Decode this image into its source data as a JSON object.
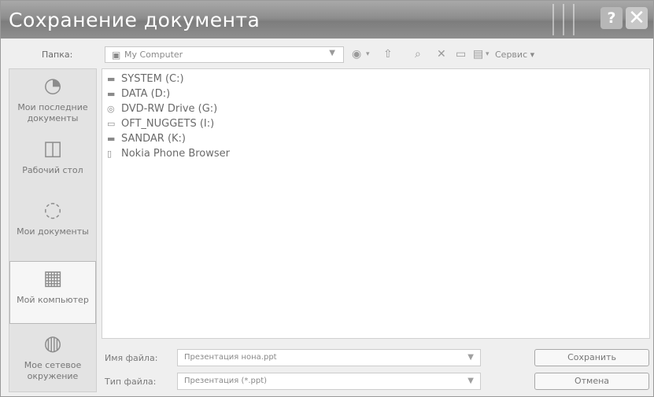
{
  "window": {
    "title": "Сохранение документа",
    "help": "?",
    "close": "✕"
  },
  "toolbar": {
    "folder_label": "Папка:",
    "folder_value": "My Computer",
    "tools_label": "Сервис"
  },
  "places": [
    {
      "label": "Мои последние документы",
      "icon": "clock-icon"
    },
    {
      "label": "Рабочий стол",
      "icon": "desktop-icon"
    },
    {
      "label": "Мои документы",
      "icon": "documents-icon"
    },
    {
      "label": "Мой компьютер",
      "icon": "computer-icon",
      "selected": true
    },
    {
      "label": "Мое сетевое окружение",
      "icon": "network-icon"
    }
  ],
  "files": [
    {
      "name": "SYSTEM (C:)",
      "icon": "drive-icon"
    },
    {
      "name": "DATA (D:)",
      "icon": "drive-icon"
    },
    {
      "name": "DVD-RW Drive (G:)",
      "icon": "dvd-icon"
    },
    {
      "name": "OFT_NUGGETS (I:)",
      "icon": "usb-drive-icon"
    },
    {
      "name": "SANDAR (K:)",
      "icon": "drive-icon"
    },
    {
      "name": "Nokia Phone Browser",
      "icon": "phone-icon"
    }
  ],
  "bottom": {
    "filename_label": "Имя файла:",
    "filename_value": "Презентация нона.ppt",
    "filetype_label": "Тип файла:",
    "filetype_value": "Презентация (*.ppt)",
    "save_button": "Сохранить",
    "cancel_button": "Отмена"
  }
}
